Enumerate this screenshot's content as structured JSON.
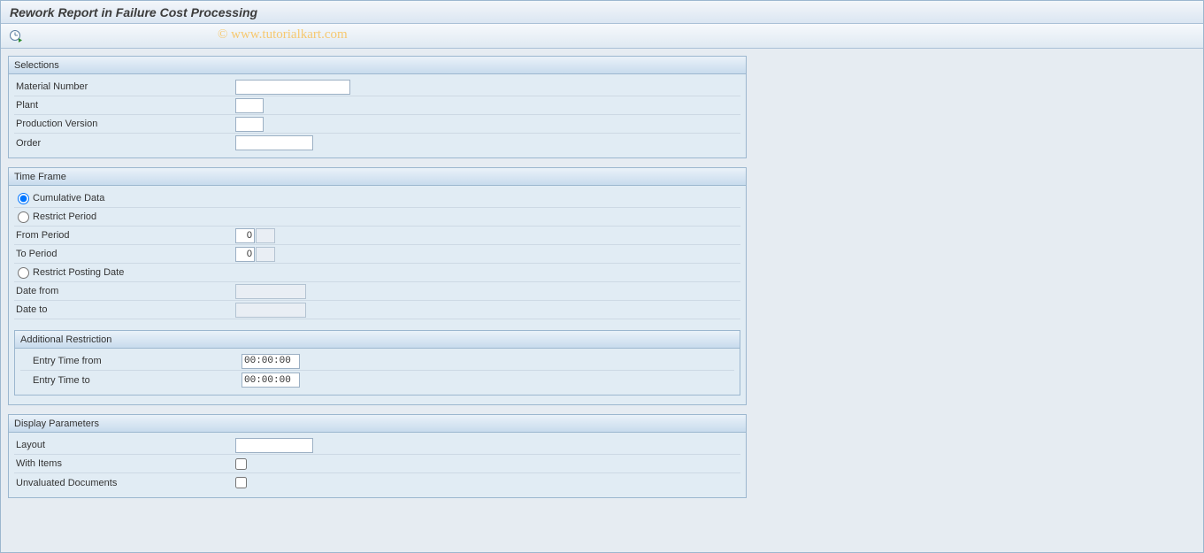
{
  "title": "Rework Report in Failure Cost Processing",
  "watermark": "© www.tutorialkart.com",
  "groups": {
    "selections": {
      "title": "Selections",
      "material_number_label": "Material Number",
      "material_number_value": "",
      "plant_label": "Plant",
      "plant_value": "",
      "production_version_label": "Production Version",
      "production_version_value": "",
      "order_label": "Order",
      "order_value": ""
    },
    "timeframe": {
      "title": "Time Frame",
      "cumulative_label": "Cumulative Data",
      "restrict_period_label": "Restrict Period",
      "from_period_label": "From Period",
      "from_period_value": "0",
      "from_period_value2": "",
      "to_period_label": "To Period",
      "to_period_value": "0",
      "to_period_value2": "",
      "restrict_posting_label": "Restrict Posting Date",
      "date_from_label": "Date from",
      "date_from_value": "",
      "date_to_label": "Date to",
      "date_to_value": "",
      "additional": {
        "title": "Additional Restriction",
        "entry_from_label": "Entry Time from",
        "entry_from_value": "00:00:00",
        "entry_to_label": "Entry Time to",
        "entry_to_value": "00:00:00"
      }
    },
    "display": {
      "title": "Display Parameters",
      "layout_label": "Layout",
      "layout_value": "",
      "with_items_label": "With Items",
      "with_items_checked": false,
      "unvaluated_label": "Unvaluated Documents",
      "unvaluated_checked": false
    }
  }
}
